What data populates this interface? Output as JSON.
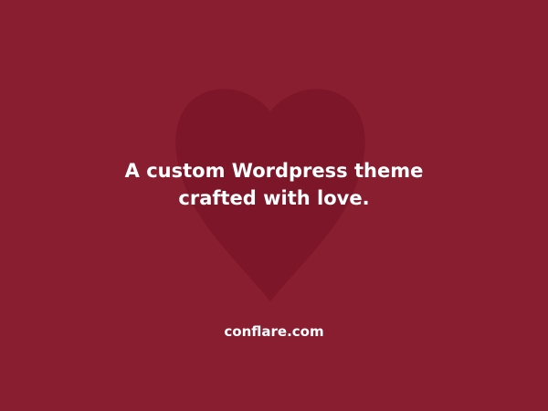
{
  "colors": {
    "background": "#8a1e31",
    "heart": "#7d1628",
    "text": "#ffffff"
  },
  "decoration": {
    "icon": "heart-icon"
  },
  "tagline": {
    "line1": "A custom Wordpress theme",
    "line2": "crafted with love."
  },
  "footer": {
    "site": "conflare.com"
  }
}
